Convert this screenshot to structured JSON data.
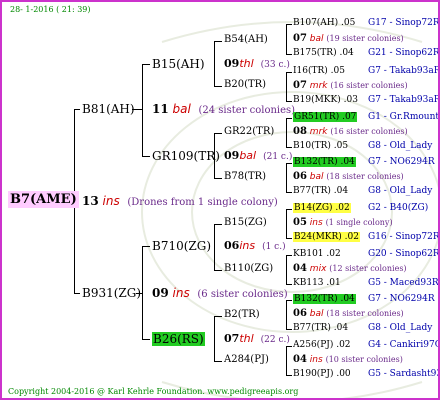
{
  "header_date": "28-  1-2016 ( 21: 39)",
  "footer": "Copyright 2004-2016 @ Karl Kehrle Foundation.   www.pedigreeapis.org",
  "root": {
    "id": "B7(AME)",
    "gen": "13",
    "suffix": "ins",
    "note": "(Drones from 1 single colony)"
  },
  "p1": {
    "id": "B81(AH)",
    "gen": "11",
    "suffix": "bal",
    "note": "(24 sister colonies)"
  },
  "p2": {
    "id": "B931(ZG)",
    "gen": "09",
    "suffix": "ins",
    "note": "(6 sister colonies)"
  },
  "g1": {
    "id": "B15(AH)",
    "gen": "09",
    "suffix": "thl",
    "note": "(33 c.)"
  },
  "g2": {
    "id": "GR109(TR)",
    "gen": "09",
    "suffix": "bal",
    "note": "(21 c.)"
  },
  "g3": {
    "id": "B710(ZG)",
    "gen": "06",
    "suffix": "ins",
    "note": "(1 c.)"
  },
  "g4": {
    "id": "B26(RS)",
    "gen": "07",
    "suffix": "thl",
    "note": "(22 c.)"
  },
  "ggp": [
    {
      "id": "B54(AH)"
    },
    {
      "id": "B20(TR)"
    },
    {
      "id": "GR22(TR)"
    },
    {
      "id": "B78(TR)"
    },
    {
      "id": "B15(ZG)"
    },
    {
      "id": "B110(ZG)"
    },
    {
      "id": "B2(TR)"
    },
    {
      "id": "A284(PJ)"
    }
  ],
  "gggp": [
    {
      "top": "B107(AH) .05",
      "topg": "G17 - Sinop72R",
      "mid_gen": "07",
      "mid_suf": "bal",
      "mid_note": "(19 sister colonies)",
      "bot": "B175(TR) .04",
      "botg": "G21 - Sinop62R"
    },
    {
      "top": "I16(TR) .05",
      "topg": "G7 - Takab93aR",
      "mid_gen": "07",
      "mid_suf": "mrk",
      "mid_note": "(16 sister colonies)",
      "bot": "B19(MKK) .03",
      "botg": "G7 - Takab93aR"
    },
    {
      "top": "GR51(TR) .07",
      "topg": "G1 - Gr.Rmounta",
      "mid_gen": "08",
      "mid_suf": "mrk",
      "mid_note": "(16 sister colonies)",
      "bot": "B10(TR) .05",
      "botg": "G8 - Old_Lady"
    },
    {
      "top": "B132(TR) .04",
      "topg": "G7 - NO6294R",
      "mid_gen": "06",
      "mid_suf": "bal",
      "mid_note": "(18 sister colonies)",
      "bot": "B77(TR) .04",
      "botg": "G8 - Old_Lady"
    },
    {
      "top": "B14(ZG) .02",
      "topg": "G2 - B40(ZG)",
      "mid_gen": "05",
      "mid_suf": "ins",
      "mid_note": "(1 single colony)",
      "bot": "B24(MKR) .02",
      "botg": "G16 - Sinop72R"
    },
    {
      "top": "KB101 .02",
      "topg": "G20 - Sinop62R",
      "mid_gen": "04",
      "mid_suf": "mix",
      "mid_note": "(12 sister colonies)",
      "bot": "KB113 .01",
      "botg": "G5 - Maced93R"
    },
    {
      "top": "B132(TR) .04",
      "topg": "G7 - NO6294R",
      "mid_gen": "06",
      "mid_suf": "bal",
      "mid_note": "(18 sister colonies)",
      "bot": "B77(TR) .04",
      "botg": "G8 - Old_Lady"
    },
    {
      "top": "A256(PJ) .02",
      "topg": "G4 - Cankiri97Q",
      "mid_gen": "04",
      "mid_suf": "ins",
      "mid_note": "(10 sister colonies)",
      "bot": "B190(PJ) .00",
      "botg": "G5 - Sardasht93R"
    }
  ]
}
